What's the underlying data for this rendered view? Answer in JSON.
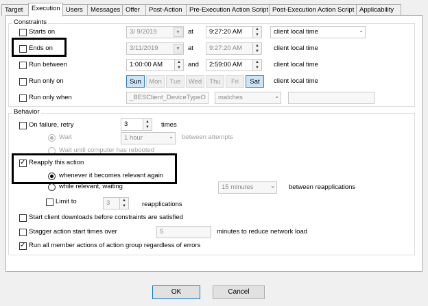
{
  "tabs": [
    "Target",
    "Execution",
    "Users",
    "Messages",
    "Offer",
    "Post-Action",
    "Pre-Execution Action Script",
    "Post-Execution Action Script",
    "Applicability"
  ],
  "constraints": {
    "title": "Constraints",
    "starts_on": {
      "label": "Starts on",
      "date": "3/ 9/2019",
      "at": "at",
      "time": "9:27:20 AM",
      "tz": "client local time"
    },
    "ends_on": {
      "label": "Ends on",
      "date": "3/11/2019",
      "at": "at",
      "time": "9:27:20 AM",
      "tz": "client local time"
    },
    "run_between": {
      "label": "Run between",
      "from": "1:00:00 AM",
      "and": "and",
      "to": "2:59:00 AM",
      "tz": "client local time"
    },
    "run_only_on": {
      "label": "Run only on",
      "days": [
        "Sun",
        "Mon",
        "Tue",
        "Wed",
        "Thu",
        "Fri",
        "Sat"
      ],
      "tz": "client local time"
    },
    "run_only_when": {
      "label": "Run only when",
      "property": "_BESClient_DeviceTypeO",
      "operator": "matches",
      "value": ""
    }
  },
  "behavior": {
    "title": "Behavior",
    "on_failure": {
      "label": "On failure, retry",
      "count": "3",
      "suffix": "times"
    },
    "wait": {
      "label": "Wait",
      "value": "1 hour",
      "suffix": "between attempts"
    },
    "wait_reboot": {
      "label": "Wait until computer has rebooted"
    },
    "reapply": {
      "label": "Reapply this action"
    },
    "reapply_relevant": {
      "label": "whenever it becomes relevant again"
    },
    "reapply_while": {
      "label": "while relevant, waiting",
      "value": "15 minutes",
      "suffix": "between reapplications"
    },
    "limit": {
      "label": "Limit to",
      "value": "3",
      "suffix": "reapplications"
    },
    "start_downloads": {
      "label": "Start client downloads before constraints are satisfied"
    },
    "stagger": {
      "label": "Stagger action start times over",
      "value": "5",
      "suffix": "minutes to reduce network load"
    },
    "run_all": {
      "label": "Run all member actions of action group regardless of errors"
    }
  },
  "buttons": {
    "ok": "OK",
    "cancel": "Cancel"
  }
}
